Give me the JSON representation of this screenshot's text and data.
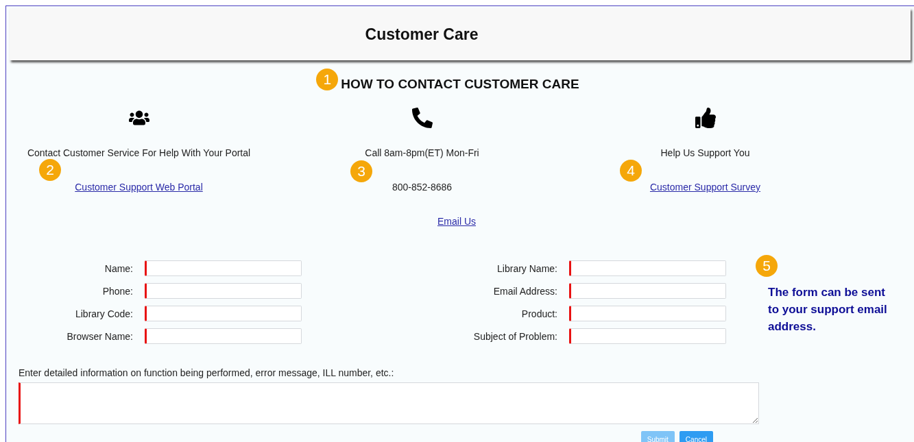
{
  "header": {
    "title": "Customer Care"
  },
  "heading": {
    "text": "HOW TO CONTACT CUSTOMER CARE",
    "callout": "1"
  },
  "contacts": [
    {
      "kind": "people",
      "text": "Contact Customer Service For Help With Your Portal",
      "callout": "2",
      "second": {
        "kind": "link",
        "text": "Customer Support Web Portal"
      }
    },
    {
      "kind": "phone",
      "text": "Call 8am-8pm(ET) Mon-Fri",
      "callout": "3",
      "second": {
        "kind": "text",
        "text": "800-852-8686"
      }
    },
    {
      "kind": "thumbs-up",
      "text": "Help Us Support You",
      "callout": "4",
      "second": {
        "kind": "link",
        "text": "Customer Support Survey"
      }
    }
  ],
  "email_link": "Email Us",
  "form": {
    "left_fields": [
      {
        "label": "Name:",
        "required": true
      },
      {
        "label": "Phone:",
        "required": true
      },
      {
        "label": "Library Code:",
        "required": true
      },
      {
        "label": "Browser Name:",
        "required": true
      }
    ],
    "right_fields": [
      {
        "label": "Library Name:",
        "required": true
      },
      {
        "label": "Email Address:",
        "required": true
      },
      {
        "label": "Product:",
        "required": true
      },
      {
        "label": "Subject of Problem:",
        "required": true
      }
    ],
    "details": {
      "label": "Enter detailed information on function being performed, error message, ILL number, etc.:",
      "required": true
    },
    "buttons": [
      {
        "label": "Submit",
        "disabled": true
      },
      {
        "label": "Cancel",
        "disabled": false
      }
    ]
  },
  "note": {
    "text": "The form can be sent to your support email address.",
    "callout": "5"
  }
}
